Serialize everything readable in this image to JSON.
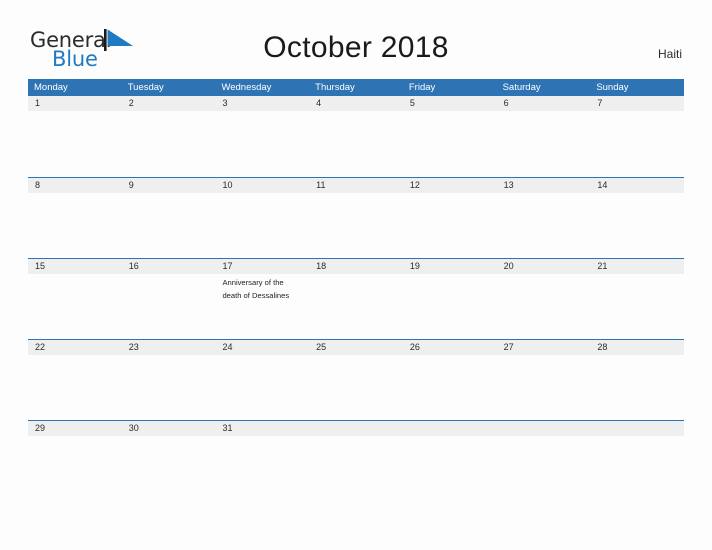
{
  "brand": {
    "word_one": "General",
    "word_two": "Blue",
    "flag_icon": "blue-flag-triangle",
    "accent_color": "#1f7ac4"
  },
  "header": {
    "title": "October 2018",
    "country": "Haiti"
  },
  "colors": {
    "header_blue": "#2e74b5",
    "number_band_gray": "#efefef",
    "page_background": "#fdfdfd",
    "text_dark": "#1f1f1f"
  },
  "calendar": {
    "month": "October",
    "year": "2018",
    "weekday_headers": [
      "Monday",
      "Tuesday",
      "Wednesday",
      "Thursday",
      "Friday",
      "Saturday",
      "Sunday"
    ],
    "weeks": [
      {
        "days": [
          {
            "number": "1",
            "event": ""
          },
          {
            "number": "2",
            "event": ""
          },
          {
            "number": "3",
            "event": ""
          },
          {
            "number": "4",
            "event": ""
          },
          {
            "number": "5",
            "event": ""
          },
          {
            "number": "6",
            "event": ""
          },
          {
            "number": "7",
            "event": ""
          }
        ]
      },
      {
        "days": [
          {
            "number": "8",
            "event": ""
          },
          {
            "number": "9",
            "event": ""
          },
          {
            "number": "10",
            "event": ""
          },
          {
            "number": "11",
            "event": ""
          },
          {
            "number": "12",
            "event": ""
          },
          {
            "number": "13",
            "event": ""
          },
          {
            "number": "14",
            "event": ""
          }
        ]
      },
      {
        "days": [
          {
            "number": "15",
            "event": ""
          },
          {
            "number": "16",
            "event": ""
          },
          {
            "number": "17",
            "event": "Anniversary of the death of Dessalines"
          },
          {
            "number": "18",
            "event": ""
          },
          {
            "number": "19",
            "event": ""
          },
          {
            "number": "20",
            "event": ""
          },
          {
            "number": "21",
            "event": ""
          }
        ]
      },
      {
        "days": [
          {
            "number": "22",
            "event": ""
          },
          {
            "number": "23",
            "event": ""
          },
          {
            "number": "24",
            "event": ""
          },
          {
            "number": "25",
            "event": ""
          },
          {
            "number": "26",
            "event": ""
          },
          {
            "number": "27",
            "event": ""
          },
          {
            "number": "28",
            "event": ""
          }
        ]
      },
      {
        "days": [
          {
            "number": "29",
            "event": ""
          },
          {
            "number": "30",
            "event": ""
          },
          {
            "number": "31",
            "event": ""
          },
          {
            "number": "",
            "event": ""
          },
          {
            "number": "",
            "event": ""
          },
          {
            "number": "",
            "event": ""
          },
          {
            "number": "",
            "event": ""
          }
        ]
      }
    ]
  }
}
